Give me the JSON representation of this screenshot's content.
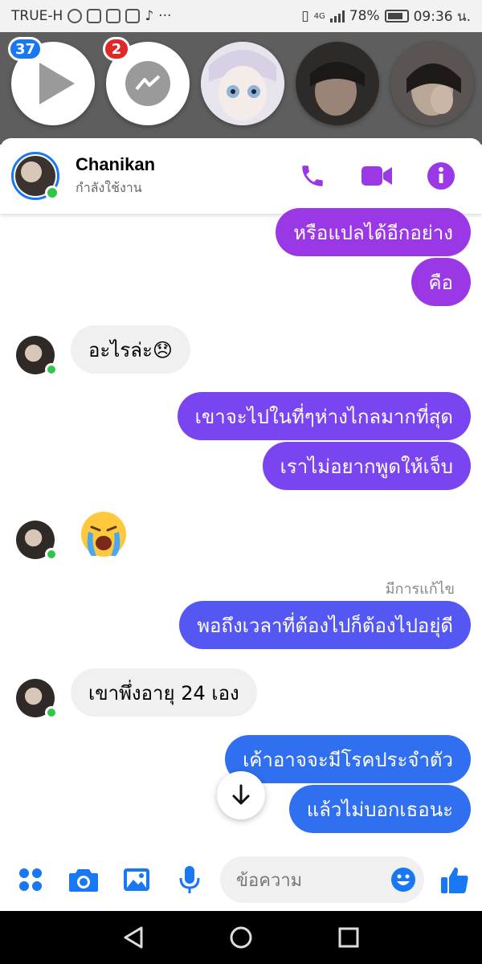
{
  "status_bar": {
    "carrier": "TRUE-H",
    "battery": "78%",
    "time": "09:36 น.",
    "network": "4G"
  },
  "chat_heads": [
    {
      "badge": "37",
      "badge_color": "#1877f2",
      "icon": "video-play-icon"
    },
    {
      "badge": "2",
      "badge_color": "#e02828",
      "icon": "messenger-icon"
    }
  ],
  "header": {
    "name": "Chanikan",
    "status": "กำลังใช้งาน"
  },
  "messages": [
    {
      "side": "out",
      "text": "หรือแปลได้อีกอย่าง",
      "color": "#9b38e6"
    },
    {
      "side": "out",
      "text": "คือ",
      "color": "#9b38e6"
    },
    {
      "side": "in",
      "text": "อะไรล่ะ😞"
    },
    {
      "side": "out",
      "text": "เขาจะไปในที่ๆห่างไกลมากที่สุด",
      "color": "#7a44f0"
    },
    {
      "side": "out",
      "text": "เราไม่อยากพูดให้เจ็บ",
      "color": "#7a44f0"
    },
    {
      "side": "in",
      "emoji": "😭"
    },
    {
      "side": "meta",
      "text": "มีการแก้ไข"
    },
    {
      "side": "out",
      "text": "พอถึงเวลาที่ต้องไปก็ต้องไปอยุ่ดี",
      "color": "#5457f2"
    },
    {
      "side": "in",
      "text": "เขาพึ่งอายุ 24 เอง"
    },
    {
      "side": "out",
      "text": "เค้าอาจจะมีโรคประจำตัว",
      "color": "#2f6ff0"
    },
    {
      "side": "out",
      "text": "แล้วไม่บอกเธอนะ",
      "color": "#2f6ff0"
    }
  ],
  "composer": {
    "placeholder": "ข้อความ"
  },
  "colors": {
    "accent_purple": "#9b38e6",
    "accent_blue": "#1877f2",
    "online_green": "#31c64a"
  }
}
